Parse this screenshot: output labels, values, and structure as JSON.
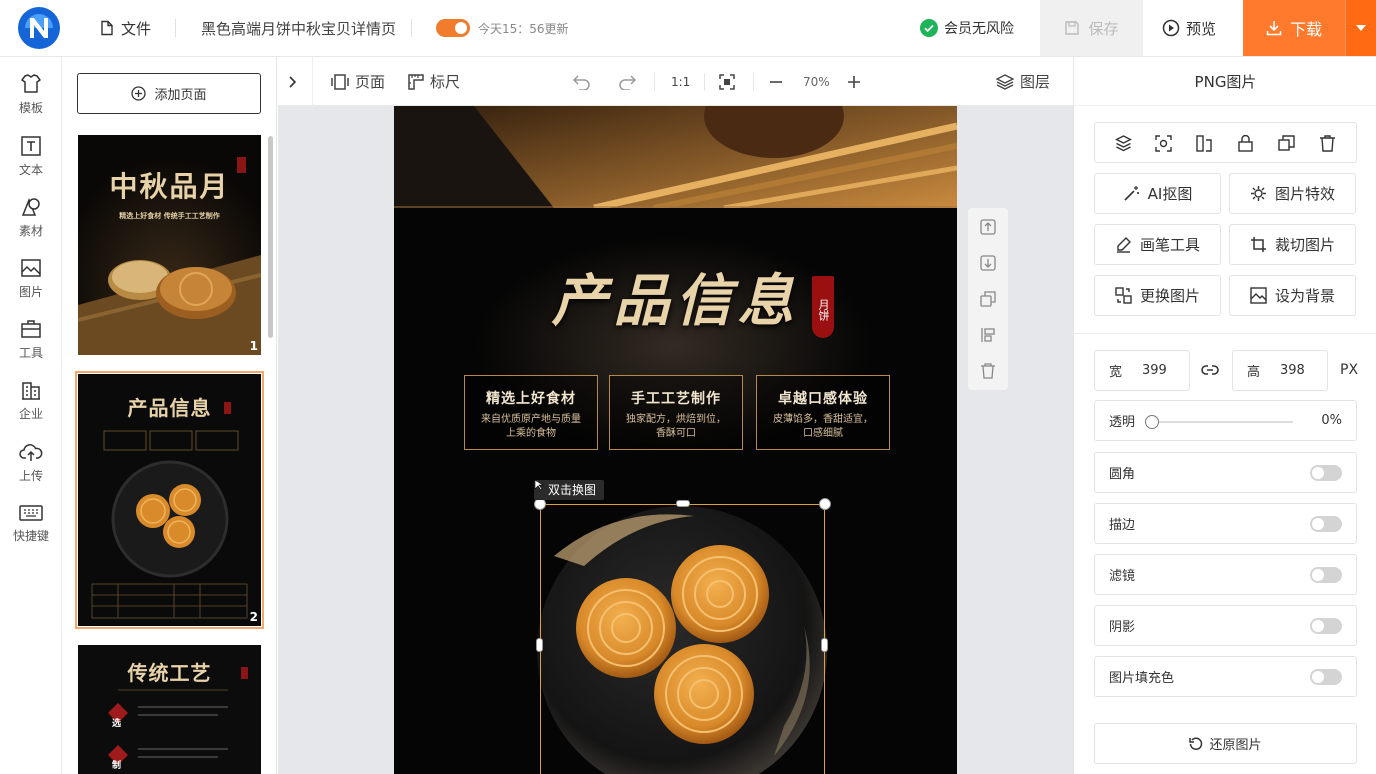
{
  "app": {
    "brand_color": "#1a5fe0",
    "accent": "#ff7a2d"
  },
  "topbar": {
    "file_label": "文件",
    "doc_title": "黑色高端月饼中秋宝贝详情页",
    "autosave_text": "今天15：56更新",
    "member_text": "会员无风险",
    "save_label": "保存",
    "preview_label": "预览",
    "download_label": "下载"
  },
  "left_nav": [
    {
      "label": "模板",
      "icon": "template-icon"
    },
    {
      "label": "文本",
      "icon": "text-icon"
    },
    {
      "label": "素材",
      "icon": "material-icon"
    },
    {
      "label": "图片",
      "icon": "image-icon"
    },
    {
      "label": "工具",
      "icon": "toolbox-icon"
    },
    {
      "label": "企业",
      "icon": "enterprise-icon"
    },
    {
      "label": "上传",
      "icon": "upload-icon"
    },
    {
      "label": "快捷键",
      "icon": "keyboard-icon"
    }
  ],
  "pages_panel": {
    "add_page_label": "添加页面",
    "thumbs": [
      {
        "num": "1",
        "title": "中秋品月",
        "subtitle": "精选上好食材 传统手工工艺制作",
        "badge": "月饼"
      },
      {
        "num": "2",
        "title": "产品信息",
        "badge": "月饼"
      },
      {
        "num": "",
        "title": "传统工艺",
        "badge": "月饼",
        "list": [
          "选",
          "制"
        ]
      }
    ]
  },
  "toolbar": {
    "page_label": "页面",
    "ruler_label": "标尺",
    "ratio_label": "1:1",
    "zoom": "70%",
    "layers_label": "图层"
  },
  "artboard": {
    "title": "产品信息",
    "seal_text": "月饼",
    "cards": [
      {
        "title": "精选上好食材",
        "desc": "来自优质原产地与质量上乘的食物"
      },
      {
        "title": "手工工艺制作",
        "desc": "独家配方，烘焙到位，香酥可口"
      },
      {
        "title": "卓越口感体验",
        "desc": "皮薄馅多，香甜适宜，口感细腻"
      }
    ],
    "replace_hint": "双击换图"
  },
  "right_panel": {
    "title": "PNG图片",
    "actions": [
      {
        "label": "AI抠图",
        "icon": "magic-wand-icon"
      },
      {
        "label": "图片特效",
        "icon": "effects-icon"
      },
      {
        "label": "画笔工具",
        "icon": "brush-icon"
      },
      {
        "label": "裁切图片",
        "icon": "crop-icon"
      },
      {
        "label": "更换图片",
        "icon": "replace-icon"
      },
      {
        "label": "设为背景",
        "icon": "background-icon"
      }
    ],
    "width_label": "宽",
    "width": "399",
    "height_label": "高",
    "height": "398",
    "unit": "PX",
    "opacity_label": "透明",
    "opacity": "0%",
    "toggles": [
      {
        "label": "圆角",
        "on": false
      },
      {
        "label": "描边",
        "on": false
      },
      {
        "label": "滤镜",
        "on": false
      },
      {
        "label": "阴影",
        "on": false
      },
      {
        "label": "图片填充色",
        "on": false
      }
    ],
    "restore_label": "还原图片"
  }
}
